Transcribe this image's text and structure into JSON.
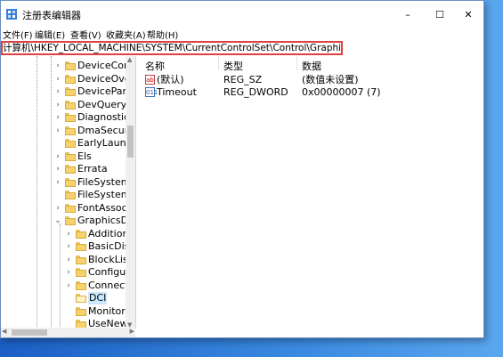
{
  "window": {
    "title": "注册表编辑器",
    "minimize": "–",
    "maximize": "☐",
    "close": "✕"
  },
  "menu": [
    "文件(F)",
    "编辑(E)",
    "查看(V)",
    "收藏夹(A)",
    "帮助(H)"
  ],
  "address": "计算机\\HKEY_LOCAL_MACHINE\\SYSTEM\\CurrentControlSet\\Control\\GraphicsDrivers\\DCI",
  "tree": [
    {
      "label": "DeviceContai",
      "level": 1,
      "expand": "›"
    },
    {
      "label": "DeviceOverri",
      "level": 1,
      "expand": "›"
    },
    {
      "label": "DevicePanels",
      "level": 1,
      "expand": "›"
    },
    {
      "label": "DevQuery",
      "level": 1,
      "expand": "›"
    },
    {
      "label": "Diagnostics",
      "level": 1,
      "expand": "›"
    },
    {
      "label": "DmaSecurity",
      "level": 1,
      "expand": "›"
    },
    {
      "label": "EarlyLaunch",
      "level": 1,
      "expand": ""
    },
    {
      "label": "Els",
      "level": 1,
      "expand": "›"
    },
    {
      "label": "Errata",
      "level": 1,
      "expand": "›"
    },
    {
      "label": "FileSystem",
      "level": 1,
      "expand": "›"
    },
    {
      "label": "FileSystemUti",
      "level": 1,
      "expand": ""
    },
    {
      "label": "FontAssoc",
      "level": 1,
      "expand": "›"
    },
    {
      "label": "GraphicsDriv",
      "level": 1,
      "expand": "⌄"
    },
    {
      "label": "Additional",
      "level": 2,
      "expand": "›"
    },
    {
      "label": "BasicDispl",
      "level": 2,
      "expand": "›"
    },
    {
      "label": "BlockList",
      "level": 2,
      "expand": "›"
    },
    {
      "label": "Configurat",
      "level": 2,
      "expand": "›"
    },
    {
      "label": "Connectivi",
      "level": 2,
      "expand": "›"
    },
    {
      "label": "DCI",
      "level": 2,
      "expand": "",
      "selected": true
    },
    {
      "label": "MonitorDa",
      "level": 2,
      "expand": ""
    },
    {
      "label": "UseNewKe",
      "level": 2,
      "expand": ""
    }
  ],
  "columns": {
    "name": "名称",
    "type": "类型",
    "data": "数据"
  },
  "values": [
    {
      "icon": "ab",
      "name": "(默认)",
      "type": "REG_SZ",
      "data": "(数值未设置)"
    },
    {
      "icon": "011",
      "name": "Timeout",
      "type": "REG_DWORD",
      "data": "0x00000007 (7)"
    }
  ],
  "scroll": {
    "up": "▲",
    "down": "▼",
    "left": "◀",
    "right": "▶"
  }
}
